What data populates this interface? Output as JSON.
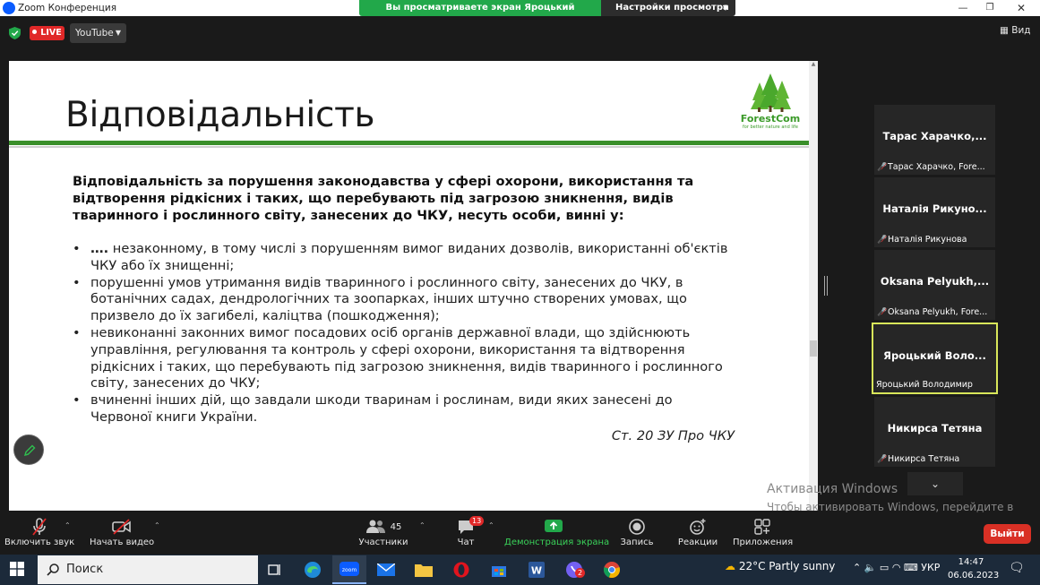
{
  "window": {
    "title": "Zoom Конференция",
    "min": "—",
    "max": "❐",
    "close": "✕"
  },
  "share_banner": {
    "text": "Вы просматриваете экран Яроцький Володимир",
    "view_options": "Настройки просмотра"
  },
  "top": {
    "live": "LIVE",
    "stream_target": "YouTube",
    "view_label": "Вид"
  },
  "slide": {
    "title": "Відповідальність",
    "logo_name": "ForestCom",
    "logo_tagline": "for better nature and life",
    "intro": "Відповідальність за порушення законодавства у сфері охорони, використання та відтворення рідкісних і таких, що перебувають під загрозою зникнення, видів тваринного і рослинного світу, занесених до ЧКУ, несуть особи, винні у:",
    "bullets": [
      {
        "lead": "….",
        "text": " незаконному, в тому числі з порушенням вимог виданих дозволів, використанні об'єктів ЧКУ або їх знищенні;"
      },
      {
        "lead": "",
        "text": "порушенні умов утримання видів тваринного і рослинного світу, занесених до ЧКУ, в ботанічних садах, дендрологічних та зоопарках, інших штучно створених умовах, що призвело до їх загибелі, каліцтва (пошкодження);"
      },
      {
        "lead": "",
        "text": "невиконанні законних вимог посадових осіб органів державної влади, що здійснюють управління, регулювання та контроль у сфері охорони, використання та відтворення рідкісних і таких, що перебувають під загрозою зникнення, видів тваринного і рослинного світу, занесених до ЧКУ;"
      },
      {
        "lead": "",
        "text": "вчиненні інших дій, що завдали шкоди тваринам і рослинам, види яких занесені до Червоної книги України."
      }
    ],
    "citation": "Ст. 20 ЗУ Про ЧКУ"
  },
  "participants": [
    {
      "big": "Тарас Харачко,...",
      "small": "Тарас Харачко, Fore...",
      "muted": true
    },
    {
      "big": "Наталія Рикуно...",
      "small": "Наталія Рикунова",
      "muted": true
    },
    {
      "big": "Oksana Pelyukh,...",
      "small": "Oksana Pelyukh, Fore...",
      "muted": true
    },
    {
      "big": "Яроцький Воло...",
      "small": "Ярoцький Володимир",
      "muted": false
    },
    {
      "big": "Никирса Тетяна",
      "small": "Никирса Тетяна",
      "muted": true
    }
  ],
  "more_tiles": "⌄",
  "watermark": {
    "line1": "Активация Windows",
    "line2": "Чтобы активировать Windows, перейдите в раздел \"Параметры\"."
  },
  "toolbar": {
    "unmute": "Включить звук",
    "start_video": "Начать видео",
    "participants": "Участники",
    "participants_count": "45",
    "chat": "Чат",
    "chat_badge": "13",
    "share": "Демонстрация экрана",
    "record": "Запись",
    "reactions": "Реакции",
    "apps": "Приложения",
    "leave": "Выйти"
  },
  "taskbar": {
    "search": "Поиск",
    "weather": "22°C  Partly sunny",
    "lang": "УКР",
    "time": "14:47",
    "date": "06.06.2023",
    "viber_badge": "2"
  },
  "colors": {
    "zoom_blue": "#0b5cff",
    "share_green": "#22a84a",
    "live_red": "#e02828",
    "leave_red": "#d93025",
    "slide_green": "#3a8f2a",
    "active_speaker": "#d8e65a"
  }
}
